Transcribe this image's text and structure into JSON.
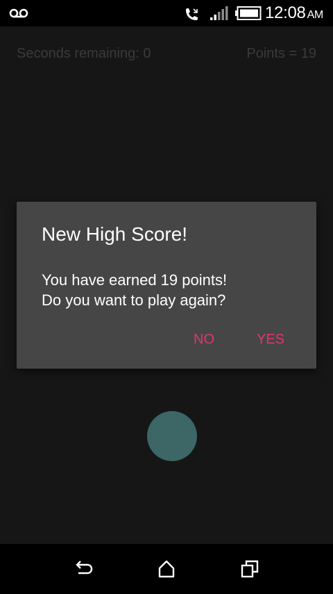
{
  "status_bar": {
    "time": "12:08",
    "ampm": "AM",
    "icons": [
      "voicemail-icon",
      "call-icon",
      "signal-icon",
      "battery-icon"
    ]
  },
  "hud": {
    "seconds_remaining": "Seconds remaining: 0",
    "points": "Points = 19"
  },
  "dialog": {
    "title": "New High Score!",
    "message_line1": "You have earned 19 points!",
    "message_line2": "Do you want to play again?",
    "no_label": "NO",
    "yes_label": "YES",
    "button_color": "#e0356e"
  },
  "game": {
    "circle_color": "#3d6666"
  },
  "nav_bar": {
    "icons": [
      "back-icon",
      "home-icon",
      "recents-icon"
    ]
  }
}
